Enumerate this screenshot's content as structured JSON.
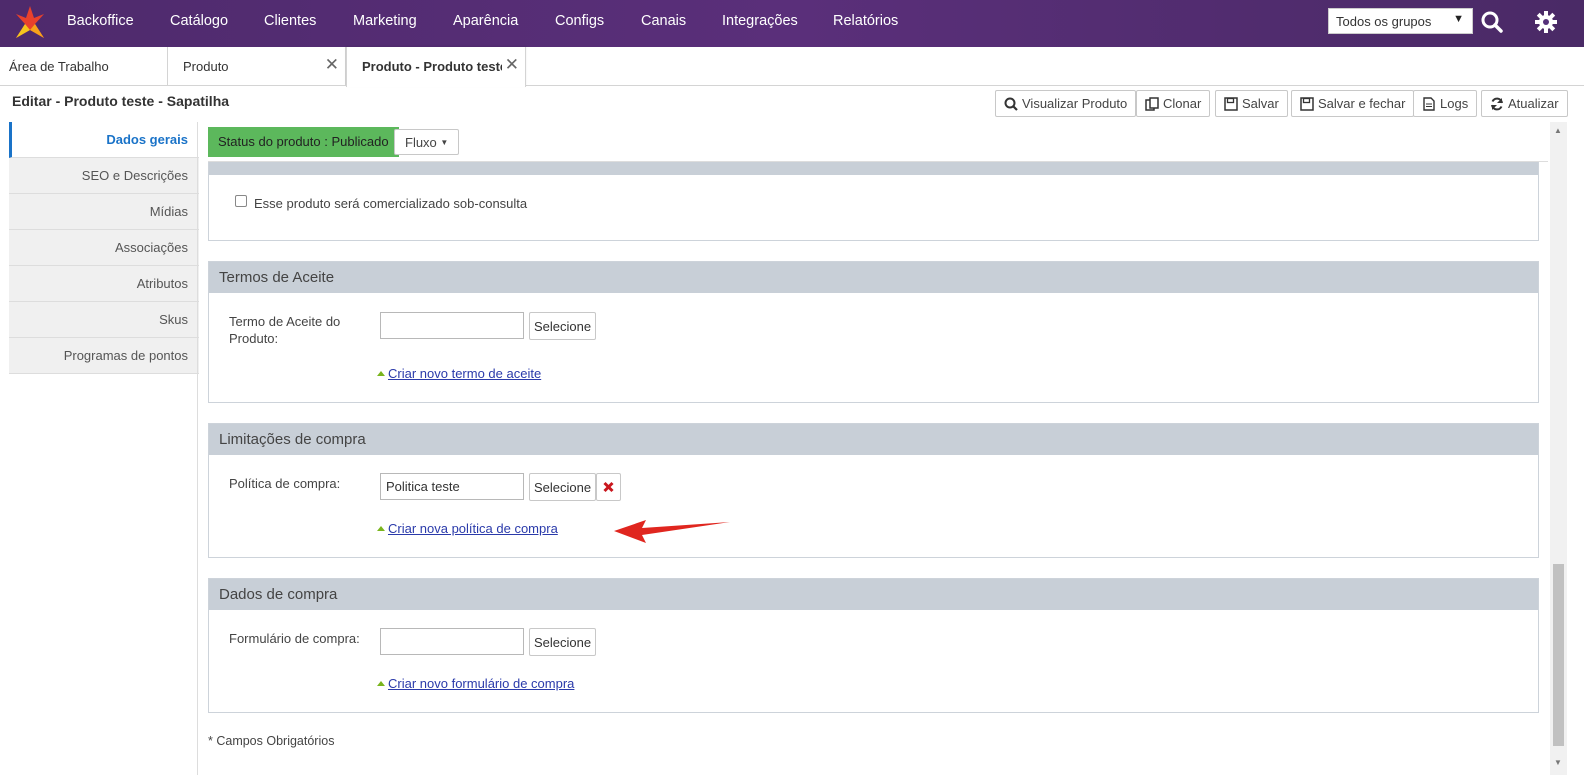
{
  "nav": {
    "items": [
      "Backoffice",
      "Catálogo",
      "Clientes",
      "Marketing",
      "Aparência",
      "Configs",
      "Canais",
      "Integrações",
      "Relatórios"
    ],
    "group_select": "Todos os grupos",
    "logo_icon": "brand-logo-icon",
    "search_icon": "search-icon",
    "settings_icon": "gear-icon"
  },
  "tabs": [
    {
      "label": "Área de Trabalho",
      "closable": false
    },
    {
      "label": "Produto",
      "closable": true
    },
    {
      "label": "Produto - Produto teste",
      "closable": true,
      "active": true
    }
  ],
  "header": {
    "title": "Editar - Produto teste - Sapatilha",
    "actions": [
      "Visualizar Produto",
      "Clonar",
      "Salvar",
      "Salvar e fechar",
      "Logs",
      "Atualizar"
    ]
  },
  "sidebar": {
    "items": [
      "Dados gerais",
      "SEO e Descrições",
      "Mídias",
      "Associações",
      "Atributos",
      "Skus",
      "Programas de pontos"
    ],
    "active": "Dados gerais"
  },
  "status": {
    "badge": "Status do produto : Publicado",
    "flow_button": "Fluxo"
  },
  "sob_consulta": {
    "checkbox_label": "Esse produto será comercializado sob-consulta"
  },
  "termos": {
    "title": "Termos de Aceite",
    "field_label": "Termo de Aceite do Produto:",
    "value": "",
    "select_button": "Selecione",
    "create_link": "Criar novo termo de aceite"
  },
  "limitacoes": {
    "title": "Limitações de compra",
    "field_label": "Política de compra:",
    "value": "Politica teste",
    "select_button": "Selecione",
    "create_link": "Criar nova política de compra"
  },
  "dados_compra": {
    "title": "Dados de compra",
    "field_label": "Formulário de compra:",
    "value": "",
    "select_button": "Selecione",
    "create_link": "Criar novo formulário de compra"
  },
  "footnote": "* Campos Obrigatórios",
  "colors": {
    "nav_bg": "#55307a",
    "status_green": "#5cb85c",
    "panel_head": "#c8cfd7",
    "active_blue": "#1a73c8",
    "arrow_red": "#e0261f"
  }
}
